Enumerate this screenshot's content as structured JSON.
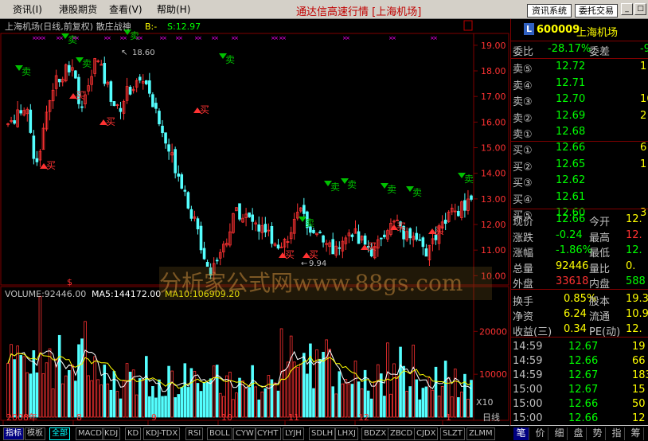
{
  "menubar": {
    "items": [
      "资讯(I)",
      "港股期货",
      "查看(V)",
      "帮助(H)"
    ],
    "app_title": "通达信高速行情 [上海机场]",
    "buttons": [
      "资讯系统",
      "委托交易"
    ],
    "window_buttons": [
      "_",
      "□",
      "×"
    ]
  },
  "chart": {
    "title": "上海机场(日线,前复权) 散庄战神",
    "indicator_b": "B:-",
    "indicator_s": "S:12.97",
    "high_label": "18.60",
    "low_label": "9.94",
    "volume_label": "VOLUME:92446.00",
    "ma5_label": "MA5:144172.00",
    "ma10_label": "MA10:106909.20",
    "period": "日线",
    "volume_unit": "X10",
    "x_labels": [
      "2008年",
      "8",
      "9",
      "10",
      "11",
      "12",
      "1"
    ],
    "price_axis": [
      "19.00",
      "18.00",
      "17.00",
      "16.00",
      "15.00",
      "14.00",
      "13.00",
      "12.00",
      "11.00",
      "10.00"
    ],
    "volume_axis": [
      "20000",
      "10000"
    ],
    "sell_text": "卖",
    "buy_text": "买",
    "watermark": "分析家公式网www.88gs.com",
    "colors": {
      "up": "#ff3232",
      "down": "#54ffff",
      "ma5": "#ffffff",
      "ma10": "#ffff00",
      "sell": "#00c000",
      "buy": "#ff3232",
      "grid": "#800000"
    }
  },
  "chart_data": {
    "type": "candlestick",
    "price_range": [
      9.7,
      19.4
    ],
    "volume_range": [
      0,
      26000
    ],
    "price_ticks": [
      19,
      18,
      17,
      16,
      15,
      14,
      13,
      12,
      11,
      10
    ],
    "volume_ticks": [
      20000,
      10000
    ],
    "last_close": 12.66
  },
  "quote": {
    "code": "600009",
    "name": "上海机场",
    "wei_bi_label": "委比",
    "wei_bi": "-28.17%",
    "wei_cha_label": "委差",
    "wei_cha": "-9",
    "asks": [
      {
        "label": "卖⑤",
        "price": "12.72",
        "vol": "1"
      },
      {
        "label": "卖④",
        "price": "12.71",
        "vol": ""
      },
      {
        "label": "卖③",
        "price": "12.70",
        "vol": "16"
      },
      {
        "label": "卖②",
        "price": "12.69",
        "vol": "2"
      },
      {
        "label": "卖①",
        "price": "12.68",
        "vol": ""
      }
    ],
    "bids": [
      {
        "label": "买①",
        "price": "12.66",
        "vol": "6"
      },
      {
        "label": "买②",
        "price": "12.65",
        "vol": "1"
      },
      {
        "label": "买③",
        "price": "12.62",
        "vol": ""
      },
      {
        "label": "买④",
        "price": "12.61",
        "vol": ""
      },
      {
        "label": "买⑤",
        "price": "12.60",
        "vol": "3"
      }
    ],
    "stats": [
      {
        "l1": "现价",
        "v1": "12.66",
        "l2": "今开",
        "v2": "12."
      },
      {
        "l1": "涨跌",
        "v1": "-0.24",
        "l2": "最高",
        "v2": "12."
      },
      {
        "l1": "涨幅",
        "v1": "-1.86%",
        "l2": "最低",
        "v2": "12."
      },
      {
        "l1": "总量",
        "v1": "92446",
        "l2": "量比",
        "v2": "0."
      },
      {
        "l1": "外盘",
        "v1": "33618",
        "l2": "内盘",
        "v2": "588"
      }
    ],
    "fundamentals": [
      {
        "l1": "换手",
        "v1": "0.85%",
        "l2": "股本",
        "v2": "19.3"
      },
      {
        "l1": "净资",
        "v1": "6.24",
        "l2": "流通",
        "v2": "10.9"
      },
      {
        "l1": "收益(三)",
        "v1": "0.34",
        "l2": "PE(动)",
        "v2": "12."
      }
    ],
    "ticks": [
      {
        "time": "14:59",
        "price": "12.67",
        "vol": "19"
      },
      {
        "time": "14:59",
        "price": "12.66",
        "vol": "66"
      },
      {
        "time": "14:59",
        "price": "12.67",
        "vol": "183"
      },
      {
        "time": "15:00",
        "price": "12.67",
        "vol": "15"
      },
      {
        "time": "15:00",
        "price": "12.66",
        "vol": "50"
      },
      {
        "time": "15:00",
        "price": "12.66",
        "vol": "12"
      }
    ]
  },
  "bottom_tabs": [
    "指标",
    "模板",
    "全部",
    "MACD",
    "KDJ",
    "KD",
    "KDJ-TDX",
    "RSI",
    "BOLL",
    "CYW",
    "CYHT",
    "LYJH",
    "SDLH",
    "LHXJ",
    "BDZX",
    "ZBCD",
    "CJDX",
    "SLZT",
    "ZLMM"
  ],
  "side_tabs": [
    "笔",
    "价",
    "细",
    "盘",
    "势",
    "指",
    "筹"
  ]
}
